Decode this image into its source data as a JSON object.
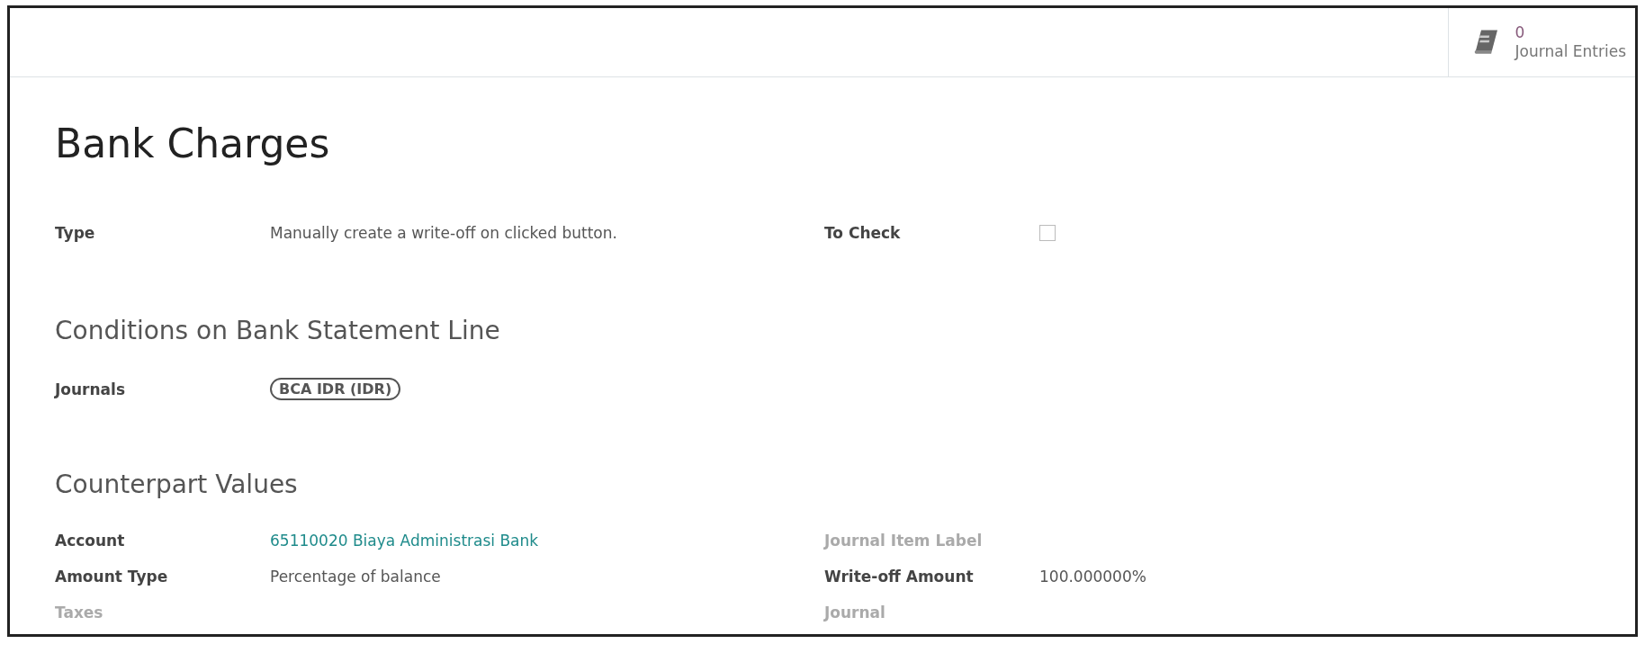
{
  "stat_button": {
    "count": "0",
    "label": "Journal Entries"
  },
  "title": "Bank Charges",
  "sections": [
    {
      "rows": [
        {
          "left": {
            "label": "Type",
            "empty": false,
            "kind": "text",
            "value": "Manually create a write-off on clicked button."
          },
          "right": {
            "label": "To Check",
            "empty": false,
            "kind": "checkbox",
            "checked": false
          }
        }
      ]
    },
    {
      "heading": "Conditions on Bank Statement Line",
      "rows": [
        {
          "left": {
            "label": "Journals",
            "empty": false,
            "kind": "tag",
            "value": "BCA IDR (IDR)"
          }
        }
      ]
    },
    {
      "heading": "Counterpart Values",
      "rows": [
        {
          "left": {
            "label": "Account",
            "empty": false,
            "kind": "link",
            "value": "65110020 Biaya Administrasi Bank"
          },
          "right": {
            "label": "Journal Item Label",
            "empty": true,
            "kind": "text"
          }
        },
        {
          "left": {
            "label": "Amount Type",
            "empty": false,
            "kind": "text",
            "value": "Percentage of balance"
          },
          "right": {
            "label": "Write-off Amount",
            "empty": false,
            "kind": "text",
            "value": "100.000000%"
          }
        },
        {
          "left": {
            "label": "Taxes",
            "empty": true,
            "kind": "text"
          },
          "right": {
            "label": "Journal",
            "empty": true,
            "kind": "text"
          }
        }
      ]
    }
  ]
}
